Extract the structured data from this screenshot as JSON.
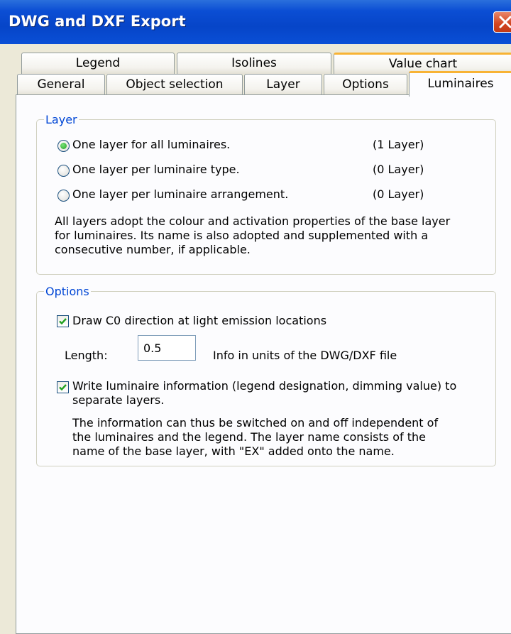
{
  "window": {
    "title": "DWG and DXF Export"
  },
  "tabs_back": [
    "Legend",
    "Isolines",
    "Value chart"
  ],
  "tabs_front": [
    "General",
    "Object selection",
    "Layer",
    "Options",
    "Luminaires"
  ],
  "active_tab": "Luminaires",
  "layer_group": {
    "title": "Layer",
    "options": [
      {
        "label": "One layer for all luminaires.",
        "count": "(1 Layer)",
        "selected": true
      },
      {
        "label": "One layer per luminaire type.",
        "count": "(0 Layer)",
        "selected": false
      },
      {
        "label": "One layer per luminaire arrangement.",
        "count": "(0 Layer)",
        "selected": false
      }
    ],
    "note_lines": [
      "All layers adopt the colour and activation properties of the base layer",
      "for luminaires. Its name is also adopted and supplemented with a",
      "consecutive number, if applicable."
    ]
  },
  "options_group": {
    "title": "Options",
    "draw_c0": {
      "label": "Draw C0 direction at light emission locations",
      "checked": true
    },
    "length": {
      "label": "Length:",
      "value": "0.5",
      "info": "Info in units of the DWG/DXF file"
    },
    "write_info": {
      "label_lines": [
        "Write luminaire information (legend designation, dimming value) to",
        "separate layers."
      ],
      "checked": true
    },
    "note_lines": [
      "The information can thus be switched on and off independent of",
      "the luminaires and the legend. The layer name consists of the",
      "name of the base layer, with \"EX\" added onto the name."
    ]
  },
  "colors": {
    "titlebar": "#0645c8",
    "group_title": "#0046d5",
    "tab_highlight": "#f8b335",
    "close_button": "#d1441f"
  }
}
